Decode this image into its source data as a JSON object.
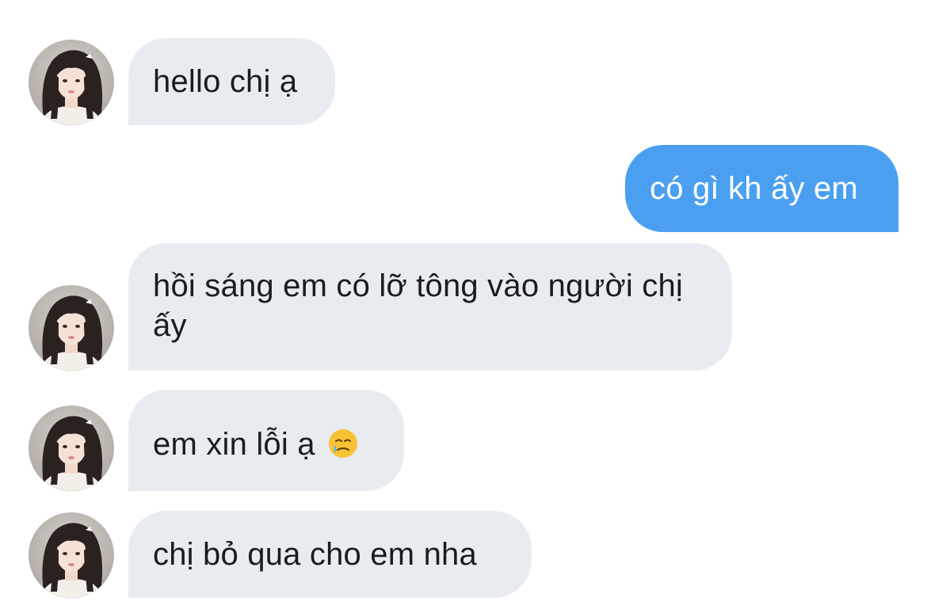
{
  "conversation": {
    "messages": [
      {
        "sender": "other",
        "text": "hello chị ạ"
      },
      {
        "sender": "me",
        "text": "có gì kh ấy em"
      },
      {
        "sender": "other",
        "text": "hồi sáng em có lỡ tông vào người chị ấy"
      },
      {
        "sender": "other",
        "text": "em xin lỗi ạ",
        "emoji": "face-holding-back-tears-icon"
      },
      {
        "sender": "other",
        "text": "chị bỏ qua cho em nha"
      }
    ]
  },
  "colors": {
    "incoming_bubble": "#e8ecf1",
    "outgoing_bubble": "#4a9ff0",
    "incoming_text": "#1c1c1e",
    "outgoing_text": "#ffffff"
  }
}
